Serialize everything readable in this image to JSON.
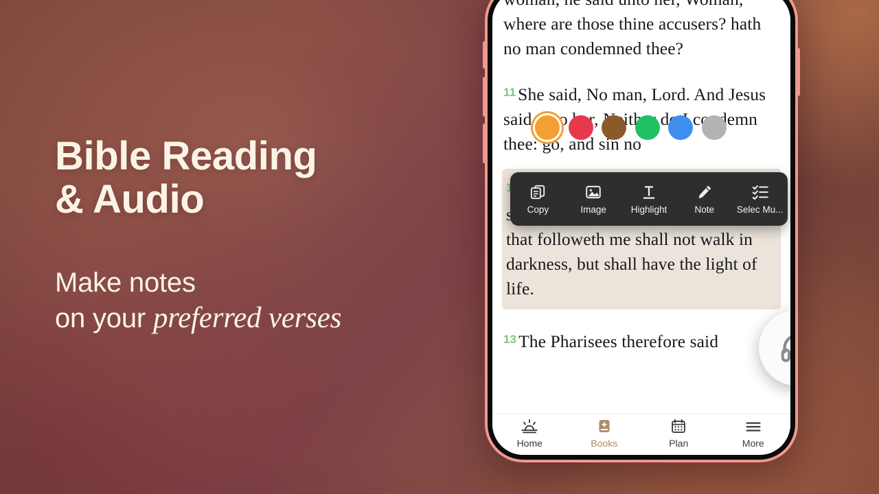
{
  "background": {
    "base_color": "#8b4f47",
    "accent_warm": "#a6644a",
    "accent_deep": "#7e4248"
  },
  "promo": {
    "headline": "Bible Reading\n& Audio",
    "sub_line1": "Make notes",
    "sub_line2_plain": "on your ",
    "sub_line2_emphasis": "preferred verses",
    "text_color": "#fbf4e6"
  },
  "phone": {
    "bezel_color": "#f2978f",
    "frame_color": "#0a0a0a",
    "screen_color": "#ffffff"
  },
  "reader": {
    "verse_number_color": "#86c183",
    "highlight_color": "#ece4da",
    "verses": [
      {
        "number": "",
        "text": "woman, he said unto her, Woman, where are those thine accusers? hath no man condemned thee?",
        "highlighted": "false"
      },
      {
        "number": "11",
        "text": "She said, No man, Lord. And Jesus said unto her, Neither do I condemn thee: go, and sin no",
        "highlighted": "false"
      },
      {
        "number": "12",
        "text": "Then spake Jesus again unto them, saying, I am the light of the world: he that followeth me shall not walk in darkness, but shall have the light of life.",
        "highlighted": "true"
      },
      {
        "number": "13",
        "text": "The Pharisees therefore said",
        "highlighted": "false"
      }
    ]
  },
  "highlight_colors": {
    "selected_index": 0,
    "swatches": [
      {
        "name": "orange",
        "hex": "#f2a033",
        "selected": "true"
      },
      {
        "name": "red",
        "hex": "#e8384f",
        "selected": "false"
      },
      {
        "name": "brown",
        "hex": "#8b5a2b",
        "selected": "false"
      },
      {
        "name": "green",
        "hex": "#21c063",
        "selected": "false"
      },
      {
        "name": "blue",
        "hex": "#3f8ef0",
        "selected": "false"
      },
      {
        "name": "gray",
        "hex": "#b3b3b3",
        "selected": "false"
      }
    ]
  },
  "context_toolbar": {
    "background": "#2e2e2e",
    "items": [
      {
        "label": "Copy",
        "icon": "copy-icon"
      },
      {
        "label": "Image",
        "icon": "image-icon"
      },
      {
        "label": "Highlight",
        "icon": "text-highlight-icon"
      },
      {
        "label": "Note",
        "icon": "pencil-icon"
      },
      {
        "label": "Selec Mu...",
        "icon": "checklist-icon"
      }
    ]
  },
  "audio_button": {
    "icon": "headphones-icon",
    "background": "#fbfafc",
    "icon_color": "#8a8a8f"
  },
  "bottom_nav": {
    "active_color": "#b08a64",
    "items": [
      {
        "label": "Home",
        "icon": "sunrise-icon",
        "active": "false"
      },
      {
        "label": "Books",
        "icon": "book-plus-icon",
        "active": "true"
      },
      {
        "label": "Plan",
        "icon": "calendar-icon",
        "active": "false"
      },
      {
        "label": "More",
        "icon": "menu-icon",
        "active": "false"
      }
    ]
  }
}
